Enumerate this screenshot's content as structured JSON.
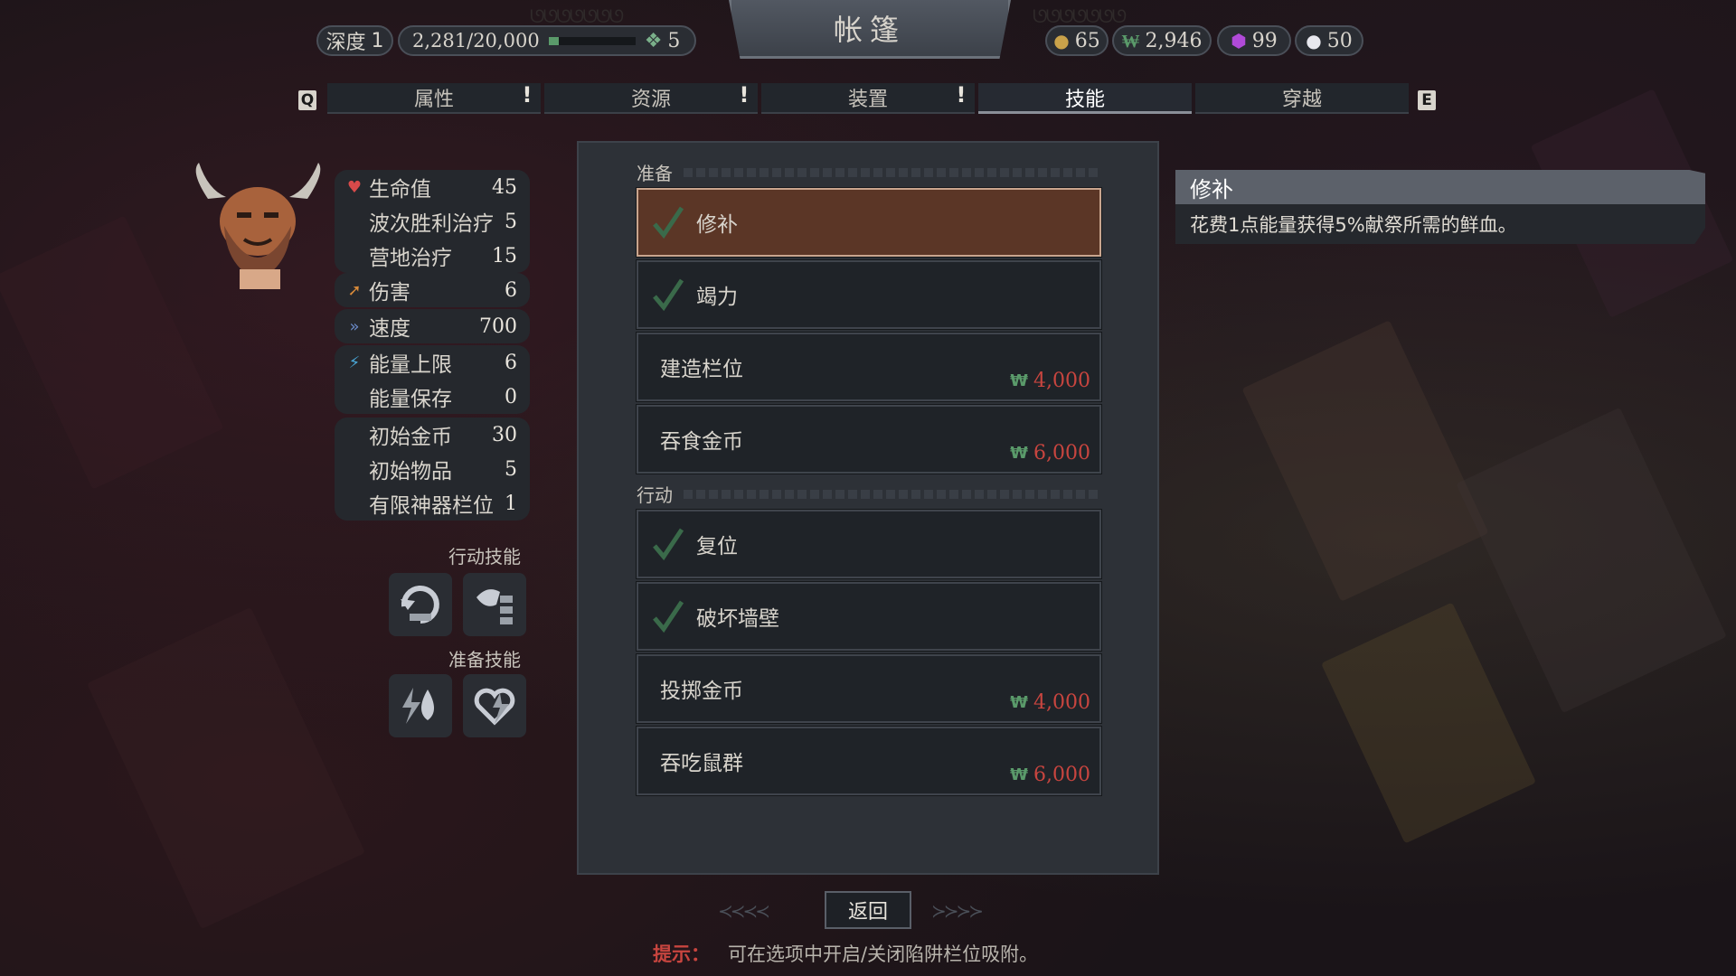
{
  "header": {
    "title": "帐篷",
    "depth_label": "深度",
    "depth_value": "1",
    "progress_text": "2,281/20,000",
    "progress_fraction": 0.114,
    "gem_value": "5",
    "resources": {
      "gold": "65",
      "blood": "2,946",
      "soul": "99",
      "pearl": "50"
    }
  },
  "tabs": {
    "key_left": "Q",
    "key_right": "E",
    "items": [
      {
        "label": "属性",
        "alert": "!"
      },
      {
        "label": "资源",
        "alert": "!"
      },
      {
        "label": "装置",
        "alert": "!"
      },
      {
        "label": "技能",
        "alert": ""
      },
      {
        "label": "穿越",
        "alert": ""
      }
    ],
    "active_index": 3
  },
  "stats": {
    "hp": {
      "label": "生命值",
      "value": "45"
    },
    "wave_heal": {
      "label": "波次胜利治疗",
      "value": "5"
    },
    "camp_heal": {
      "label": "营地治疗",
      "value": "15"
    },
    "damage": {
      "label": "伤害",
      "value": "6"
    },
    "speed": {
      "label": "速度",
      "value": "700"
    },
    "energy_max": {
      "label": "能量上限",
      "value": "6"
    },
    "energy_keep": {
      "label": "能量保存",
      "value": "0"
    },
    "start_gold": {
      "label": "初始金币",
      "value": "30"
    },
    "start_items": {
      "label": "初始物品",
      "value": "5"
    },
    "relic_slots": {
      "label": "有限神器栏位",
      "value": "1"
    }
  },
  "skills_side": {
    "action_heading": "行动技能",
    "prep_heading": "准备技能"
  },
  "panel": {
    "prep_label": "准备",
    "action_label": "行动",
    "prep_skills": [
      {
        "name": "修补",
        "owned": true,
        "cost": ""
      },
      {
        "name": "竭力",
        "owned": true,
        "cost": ""
      },
      {
        "name": "建造栏位",
        "owned": false,
        "cost": "4,000"
      },
      {
        "name": "吞食金币",
        "owned": false,
        "cost": "6,000"
      }
    ],
    "action_skills": [
      {
        "name": "复位",
        "owned": true,
        "cost": ""
      },
      {
        "name": "破坏墙壁",
        "owned": true,
        "cost": ""
      },
      {
        "name": "投掷金币",
        "owned": false,
        "cost": "4,000"
      },
      {
        "name": "吞吃鼠群",
        "owned": false,
        "cost": "6,000"
      }
    ]
  },
  "tooltip": {
    "title": "修补",
    "description": "花费1点能量获得5%献祭所需的鲜血。"
  },
  "footer": {
    "back_label": "返回",
    "hint_label": "提示：",
    "hint_text": "可在选项中开启/关闭陷阱栏位吸附。"
  },
  "colors": {
    "selected_row": "#5b3626",
    "cost_red": "#c8453f",
    "blood_green": "#5a9a6a",
    "alert_purple": "#6a3fb0"
  }
}
